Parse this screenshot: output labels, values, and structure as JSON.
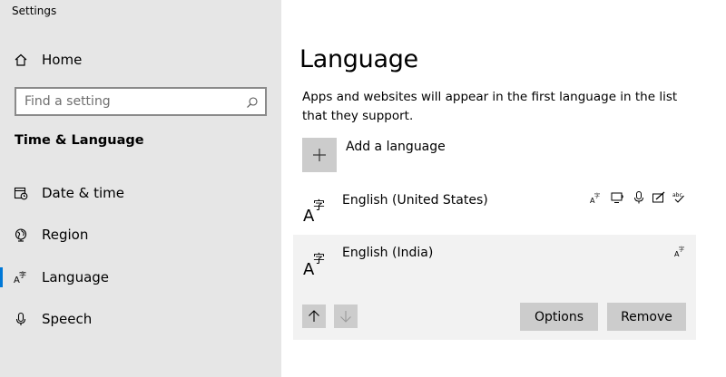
{
  "window": {
    "title": "Settings"
  },
  "sidebar": {
    "home": {
      "label": "Home",
      "icon": "home-icon"
    },
    "search": {
      "placeholder": "Find a setting",
      "icon": "search-icon"
    },
    "section_title": "Time & Language",
    "items": [
      {
        "label": "Date & time",
        "icon": "calendar-clock-icon",
        "active": false
      },
      {
        "label": "Region",
        "icon": "globe-icon",
        "active": false
      },
      {
        "label": "Language",
        "icon": "language-icon",
        "active": true
      },
      {
        "label": "Speech",
        "icon": "microphone-icon",
        "active": false
      }
    ]
  },
  "main": {
    "title": "Language",
    "description": "Apps and websites will appear in the first language in the list that they support.",
    "add_language_label": "Add a language",
    "languages": [
      {
        "name": "English (United States)",
        "features": [
          "display-language-icon",
          "text-to-speech-icon",
          "speech-recognition-icon",
          "handwriting-icon",
          "spell-check-icon"
        ],
        "selected": false
      },
      {
        "name": "English (India)",
        "features": [
          "display-language-icon"
        ],
        "selected": true
      }
    ],
    "buttons": {
      "move_up": "arrow-up-icon",
      "move_down": "arrow-down-icon",
      "options": "Options",
      "remove": "Remove"
    }
  },
  "colors": {
    "sidebar_bg": "#e6e6e6",
    "accent": "#0078d7",
    "button_bg": "#cccccc",
    "selected_row_bg": "#f2f2f2"
  }
}
